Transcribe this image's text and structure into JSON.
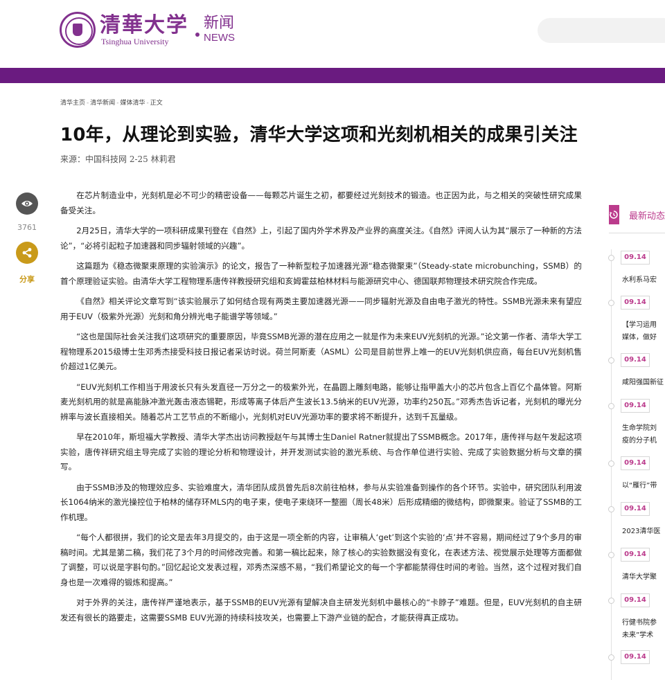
{
  "header": {
    "university_cn": "清華大学",
    "university_en": "Tsinghua University",
    "news_cn": "新闻",
    "news_en": "NEWS"
  },
  "breadcrumb": [
    "清华主页",
    "清华新闻",
    "媒体清华",
    "正文"
  ],
  "breadcrumb_sep": "-",
  "article": {
    "title": "10年，从理论到实验，清华大学这项和光刻机相关的成果引关注",
    "source": "来源：中国科技网 2-25 林莉君",
    "paragraphs": [
      "在芯片制造业中，光刻机是必不可少的精密设备——每颗芯片诞生之初，都要经过光刻技术的锻造。也正因为此，与之相关的突破性研究成果备受关注。",
      "2月25日，清华大学的一项科研成果刊登在《自然》上，引起了国内外学术界及产业界的高度关注。《自然》评阅人认为其“展示了一种新的方法论”，“必将引起粒子加速器和同步辐射领域的兴趣”。",
      "这篇题为《稳态微聚束原理的实验演示》的论文，报告了一种新型粒子加速器光源“稳态微聚束”（Steady-state microbunching，SSMB）的首个原理验证实验。由清华大学工程物理系唐传祥教授研究组和亥姆霍兹柏林材料与能源研究中心、德国联邦物理技术研究院合作完成。",
      "《自然》相关评论文章写到“该实验展示了如何结合现有两类主要加速器光源——同步辐射光源及自由电子激光的特性。SSMB光源未来有望应用于EUV（极紫外光源）光刻和角分辨光电子能谱学等领域。”",
      "“这也是国际社会关注我们这项研究的重要原因，毕竟SSMB光源的潜在应用之一就是作为未来EUV光刻机的光源。”论文第一作者、清华大学工程物理系2015级博士生邓秀杰接受科技日报记者采访时说。荷兰阿斯麦（ASML）公司是目前世界上唯一的EUV光刻机供应商，每台EUV光刻机售价超过1亿美元。",
      "“EUV光刻机工作相当于用波长只有头发直径一万分之一的极紫外光，在晶圆上雕刻电路，能够让指甲盖大小的芯片包含上百亿个晶体管。阿斯麦光刻机用的就是高能脉冲激光轰击液态锡靶，形成等离子体后产生波长13.5纳米的EUV光源，功率约250瓦。”邓秀杰告诉记者，光刻机的曝光分辨率与波长直接相关。随着芯片工艺节点的不断缩小，光刻机对EUV光源功率的要求将不断提升，达到千瓦量级。",
      "早在2010年，斯坦福大学教授、清华大学杰出访问教授赵午与其博士生Daniel Ratner就提出了SSMB概念。2017年，唐传祥与赵午发起这项实验，唐传祥研究组主导完成了实验的理论分析和物理设计，并开发测试实验的激光系统、与合作单位进行实验、完成了实验数据分析与文章的撰写。",
      "由于SSMB涉及的物理效应多、实验难度大，清华团队成员曾先后8次前往柏林，参与从实验准备到操作的各个环节。实验中，研究团队利用波长1064纳米的激光操控位于柏林的储存环MLS内的电子束，使电子束绕环一整圈（周长48米）后形成精细的微结构，即微聚束。验证了SSMB的工作机理。",
      "“每个人都很拼，我们的论文是去年3月提交的，由于这是一项全新的内容，让审稿人‘get’到这个实验的‘点’并不容易，期间经过了9个多月的审稿时间。尤其是第二稿，我们花了3个月的时间修改完善。和第一稿比起来，除了核心的实验数据没有变化，在表述方法、视觉展示处理等方面都做了调整，可以说是字斟句酌。”回忆起论文发表过程，邓秀杰深感不易，“我们希望论文的每一个字都能禁得住时间的考验。当然，这个过程对我们自身也是一次难得的锻炼和提高。”",
      "对于外界的关注，唐传祥严谨地表示，基于SSMB的EUV光源有望解决自主研发光刻机中最核心的“卡脖子”难题。但是，EUV光刻机的自主研发还有很长的路要走，这需要SSMB EUV光源的持续科技攻关，也需要上下游产业链的配合，才能获得真正成功。"
    ]
  },
  "share": {
    "views": "3761",
    "share_label": "分享"
  },
  "sidebar": {
    "title": "最新动态",
    "accent": "#bb3b8c",
    "items": [
      {
        "date": "09.14",
        "text": "水利系马宏"
      },
      {
        "date": "09.14",
        "text": "【学习运用",
        "text2": "媒体，做好"
      },
      {
        "date": "09.14",
        "text": "咸阳强国新征"
      },
      {
        "date": "09.14",
        "text": "生命学院刘",
        "text2": "疫的分子机"
      },
      {
        "date": "09.14",
        "text": "以“雁行”带"
      },
      {
        "date": "09.14",
        "text": "2023清华医"
      },
      {
        "date": "09.14",
        "text": "清华大学聚"
      },
      {
        "date": "09.14",
        "text": "行健书院参",
        "text2": "未来”学术"
      },
      {
        "date": "09.14",
        "text": ""
      }
    ]
  },
  "colors": {
    "brand_purple": "#82318e",
    "bar_purple": "#6a1b80",
    "share_gold": "#c99a1a"
  }
}
